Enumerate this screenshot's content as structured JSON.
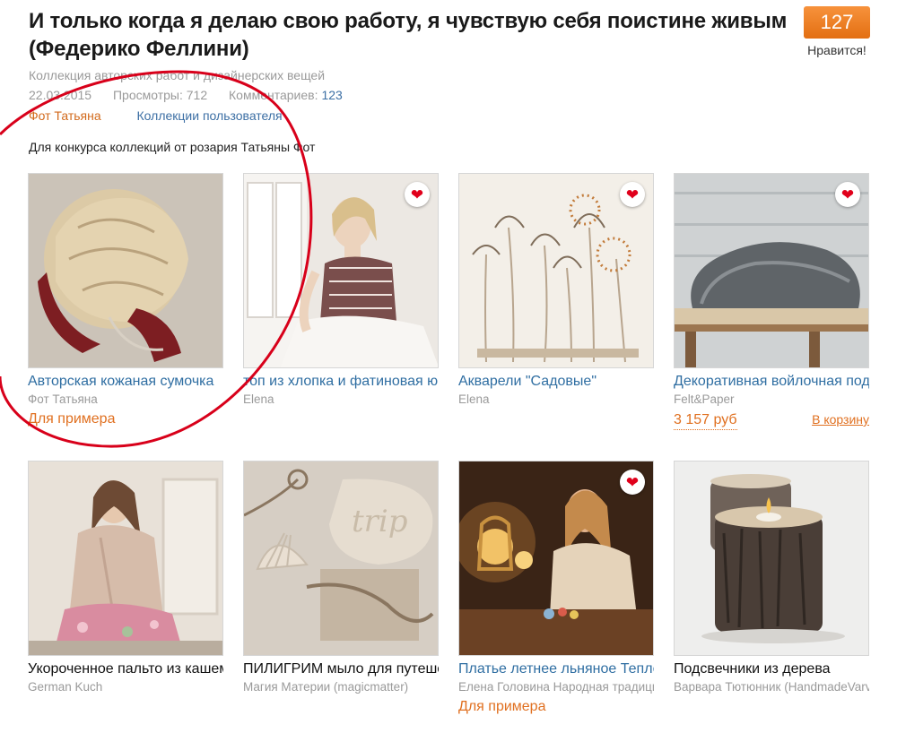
{
  "collection": {
    "title": "И только когда я делаю свою работу, я чувствую себя поистине живым (Федерико Феллини)",
    "subtitle": "Коллекция авторских работ и дизайнерских вещей",
    "date": "22.03.2015",
    "views_label": "Просмотры: 712",
    "comments_label": "Комментариев:",
    "comments_count": "123",
    "author": "Фот Татьяна",
    "user_collections": "Коллекции пользователя",
    "description": "Для конкурса коллекций от розария Татьяны Фот"
  },
  "likes": {
    "count": "127",
    "label": "Нравится!"
  },
  "colors": {
    "accent": "#e07020",
    "link": "#2f6ea2",
    "like_button": "#f08020",
    "favorite": "#e0001b",
    "annotation_circle": "#d8001a"
  },
  "items": [
    {
      "title": "Авторская кожаная сумочка",
      "author": "Фот Татьяна",
      "status": "Для примера",
      "favorite": false,
      "image": "leather-rose-bag-photo"
    },
    {
      "title": "топ из хлопка и фатиновая юбка",
      "author": "Elena",
      "status": "",
      "favorite": true,
      "image": "woman-in-checked-top-photo"
    },
    {
      "title": "Акварели \"Садовые\"",
      "author": "Elena",
      "status": "",
      "favorite": true,
      "image": "watercolor-dandelions-photo"
    },
    {
      "title": "Декоративная войлочная подушка",
      "author": "Felt&Paper",
      "price": "3 157 руб",
      "cart": "В корзину",
      "favorite": true,
      "image": "felt-stone-pillow-photo"
    },
    {
      "title": "Укороченное пальто из кашемира",
      "author": "German Kuch",
      "status": "",
      "favorite": false,
      "image": "woman-in-coat-photo"
    },
    {
      "title": "ПИЛИГРИМ мыло для путешествий",
      "author": "Магия Материи (magicmatter)",
      "status": "",
      "favorite": false,
      "image": "trip-soap-and-shells-photo"
    },
    {
      "title": "Платье летнее льняное Тепло",
      "author": "Елена Головина Народная традиция",
      "status": "Для примера",
      "favorite": true,
      "image": "woman-with-lamps-photo"
    },
    {
      "title": "Подсвечники из дерева",
      "author": "Варвара Тютюнник (HandmadeVarvara)",
      "status": "",
      "favorite": false,
      "image": "wooden-candle-holders-photo"
    }
  ]
}
